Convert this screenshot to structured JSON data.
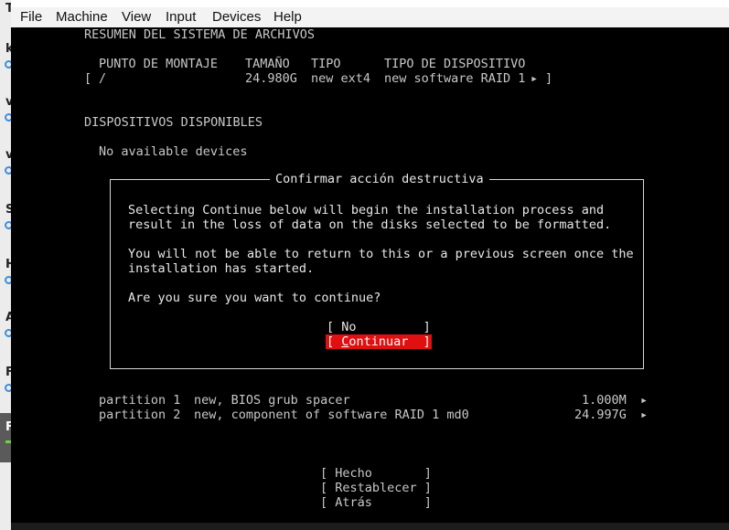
{
  "host_strip": {
    "letters": [
      "T",
      "k",
      "v",
      "v",
      "S",
      "H",
      "A",
      "F",
      "F"
    ]
  },
  "menubar": {
    "items": [
      "File",
      "Machine",
      "View",
      "Input",
      "Devices",
      "Help"
    ]
  },
  "installer": {
    "fs_summary_title": "RESUMEN DEL SISTEMA DE ARCHIVOS",
    "fs_columns": {
      "mount": "PUNTO DE MONTAJE",
      "size": "TAMAÑO",
      "type": "TIPO",
      "device_type": "TIPO DE DISPOSITIVO"
    },
    "fs_row": {
      "open": "[",
      "mount": "/",
      "size": "24.980G",
      "type": "new ext4",
      "device_type": "new software RAID 1",
      "arrow": "▸",
      "close": "]"
    },
    "available_title": "DISPOSITIVOS DISPONIBLES",
    "no_devices": "No available devices",
    "partitions": [
      {
        "name": "partition 1",
        "desc": "new, BIOS grub spacer",
        "size": "1.000M",
        "arrow": "▸"
      },
      {
        "name": "partition 2",
        "desc": "new, component of software RAID 1 md0",
        "size": "24.997G",
        "arrow": "▸"
      }
    ],
    "bottom_buttons": {
      "done": "[ Hecho       ]",
      "reset": "[ Restablecer ]",
      "back": "[ Atrás       ]"
    }
  },
  "dialog": {
    "title": "Confirmar acción destructiva",
    "lines": [
      "Selecting Continue below will begin the installation process and",
      "result in the loss of data on the disks selected to be formatted.",
      "You will not be able to return to this or a previous screen once the",
      "installation has started.",
      "Are you sure you want to continue?"
    ],
    "no_button": "[ No         ]",
    "continue_open": "[ ",
    "continue_hot": "C",
    "continue_rest": "ontinuar  ]"
  }
}
